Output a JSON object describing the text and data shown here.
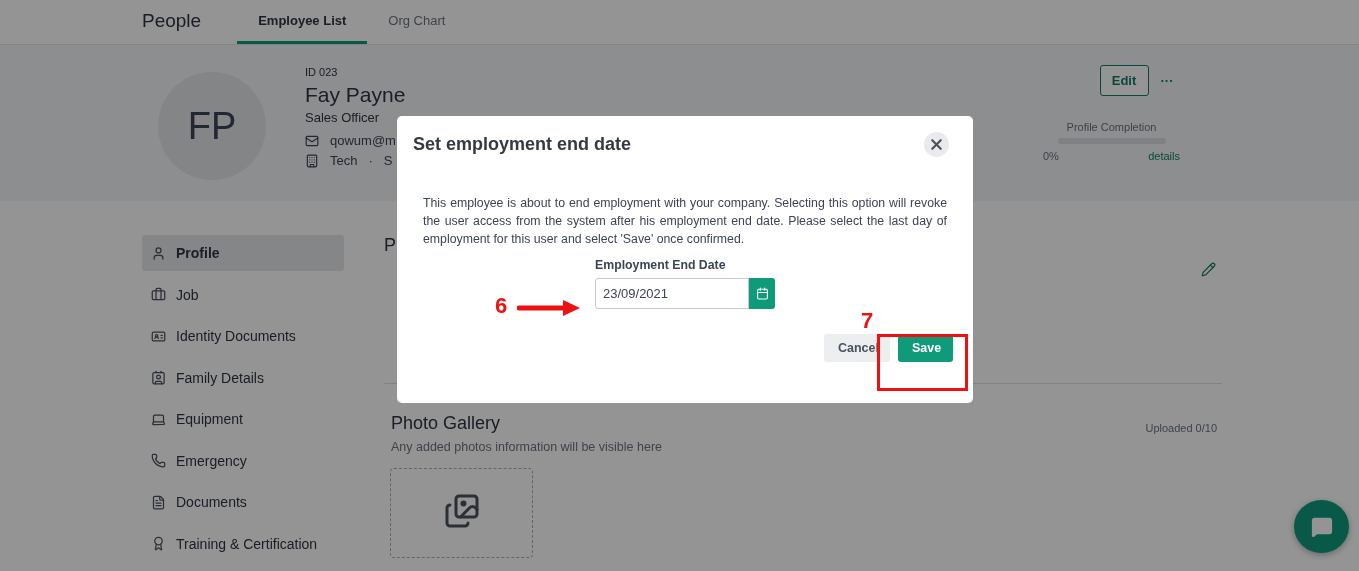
{
  "app": {
    "title": "People",
    "tabs": [
      {
        "label": "Employee List",
        "selected": true
      },
      {
        "label": "Org Chart",
        "selected": false
      }
    ]
  },
  "employee": {
    "initials": "FP",
    "id": "ID 023",
    "name": "Fay Payne",
    "role": "Sales Officer",
    "email": "qowum@m",
    "department": "Tech",
    "separator": "·",
    "location": "S"
  },
  "actions": {
    "edit": "Edit",
    "more": "···"
  },
  "profile_completion": {
    "label": "Profile Completion",
    "level": 0,
    "percent": "0%",
    "link": "details"
  },
  "sidebar": {
    "items": [
      {
        "label": "Profile",
        "selected": true
      },
      {
        "label": "Job",
        "selected": false
      },
      {
        "label": "Identity Documents",
        "selected": false
      },
      {
        "label": "Family Details",
        "selected": false
      },
      {
        "label": "Equipment",
        "selected": false
      },
      {
        "label": "Emergency",
        "selected": false
      },
      {
        "label": "Documents",
        "selected": false
      },
      {
        "label": "Training & Certification",
        "selected": false
      }
    ]
  },
  "section": {
    "heading": "P"
  },
  "gallery": {
    "title": "Photo Gallery",
    "subtitle": "Any added photos information will be visible here",
    "count": "Uploaded 0/10"
  },
  "dialog": {
    "title": "Set employment end date",
    "body": "This employee is about to end employment with your company. Selecting this option will revoke the user access from the system after his employment end date. Please select the last day of employment for this user and select 'Save' once confirmed.",
    "field": {
      "label": "Employment End Date",
      "value": "23/09/2021"
    },
    "buttons": [
      {
        "label": "Cancel",
        "kind": "secondary"
      },
      {
        "label": "Save",
        "kind": "primary"
      }
    ]
  },
  "annotations": [
    {
      "label": "6",
      "kind": "arrow"
    },
    {
      "label": "7",
      "kind": "box"
    }
  ]
}
